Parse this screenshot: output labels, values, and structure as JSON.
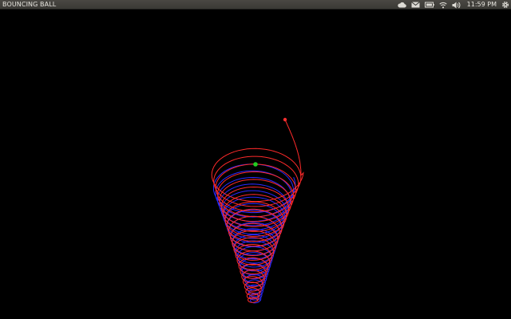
{
  "window": {
    "title": "BOUNCING BALL"
  },
  "panel": {
    "indicators": [
      {
        "icon": "cloud-sync-icon"
      },
      {
        "icon": "mail-envelope-icon"
      },
      {
        "icon": "battery-icon"
      },
      {
        "icon": "wifi-signal-icon"
      },
      {
        "icon": "volume-speaker-icon"
      }
    ],
    "clock": "11:59 PM",
    "session_icon": "gear-power-icon"
  },
  "scene": {
    "background": "#000000",
    "trail_red": "#ff2a2a",
    "trail_blue": "#2a2aff",
    "ball_red": "#ff3030",
    "ball_green": "#22cc22"
  }
}
